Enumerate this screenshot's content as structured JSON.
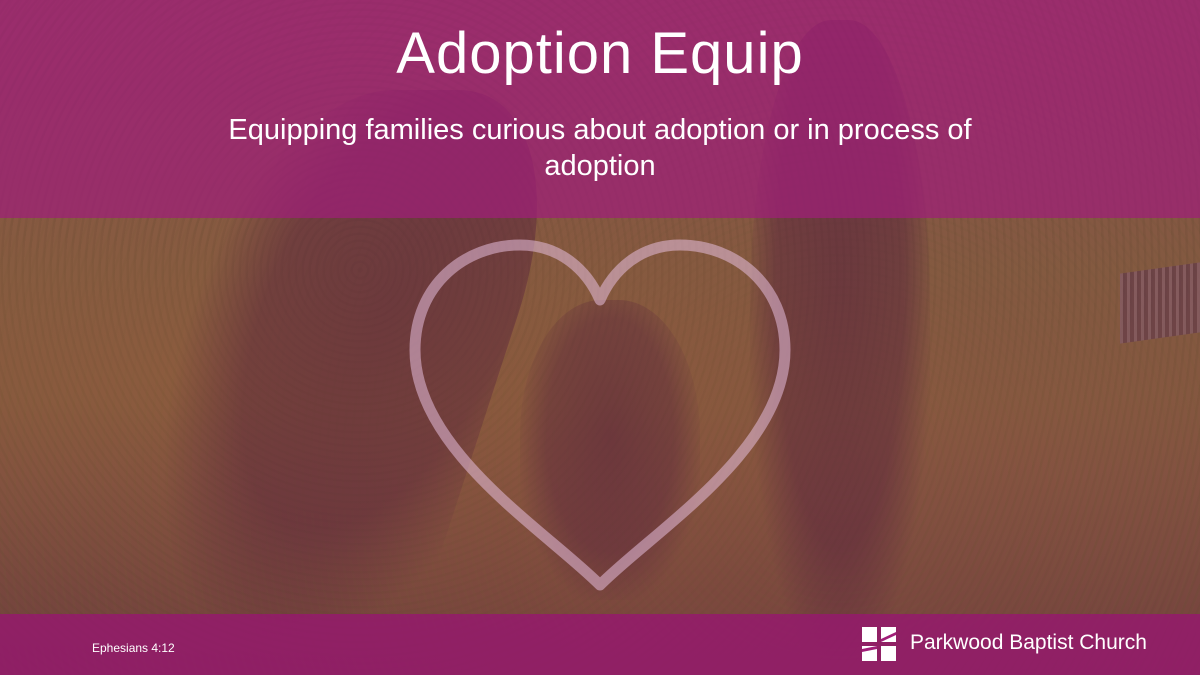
{
  "slide": {
    "title": "Adoption Equip",
    "subtitle": "Equipping families curious about adoption or in process of adoption",
    "verse": "Ephesians 4:12",
    "church_name": "Parkwood Baptist Church",
    "logo_icon": "parkwood-cross-logo-icon",
    "heart_icon": "heart-outline-icon"
  },
  "colors": {
    "band": "#A01E78",
    "text": "#FFFFFF"
  }
}
